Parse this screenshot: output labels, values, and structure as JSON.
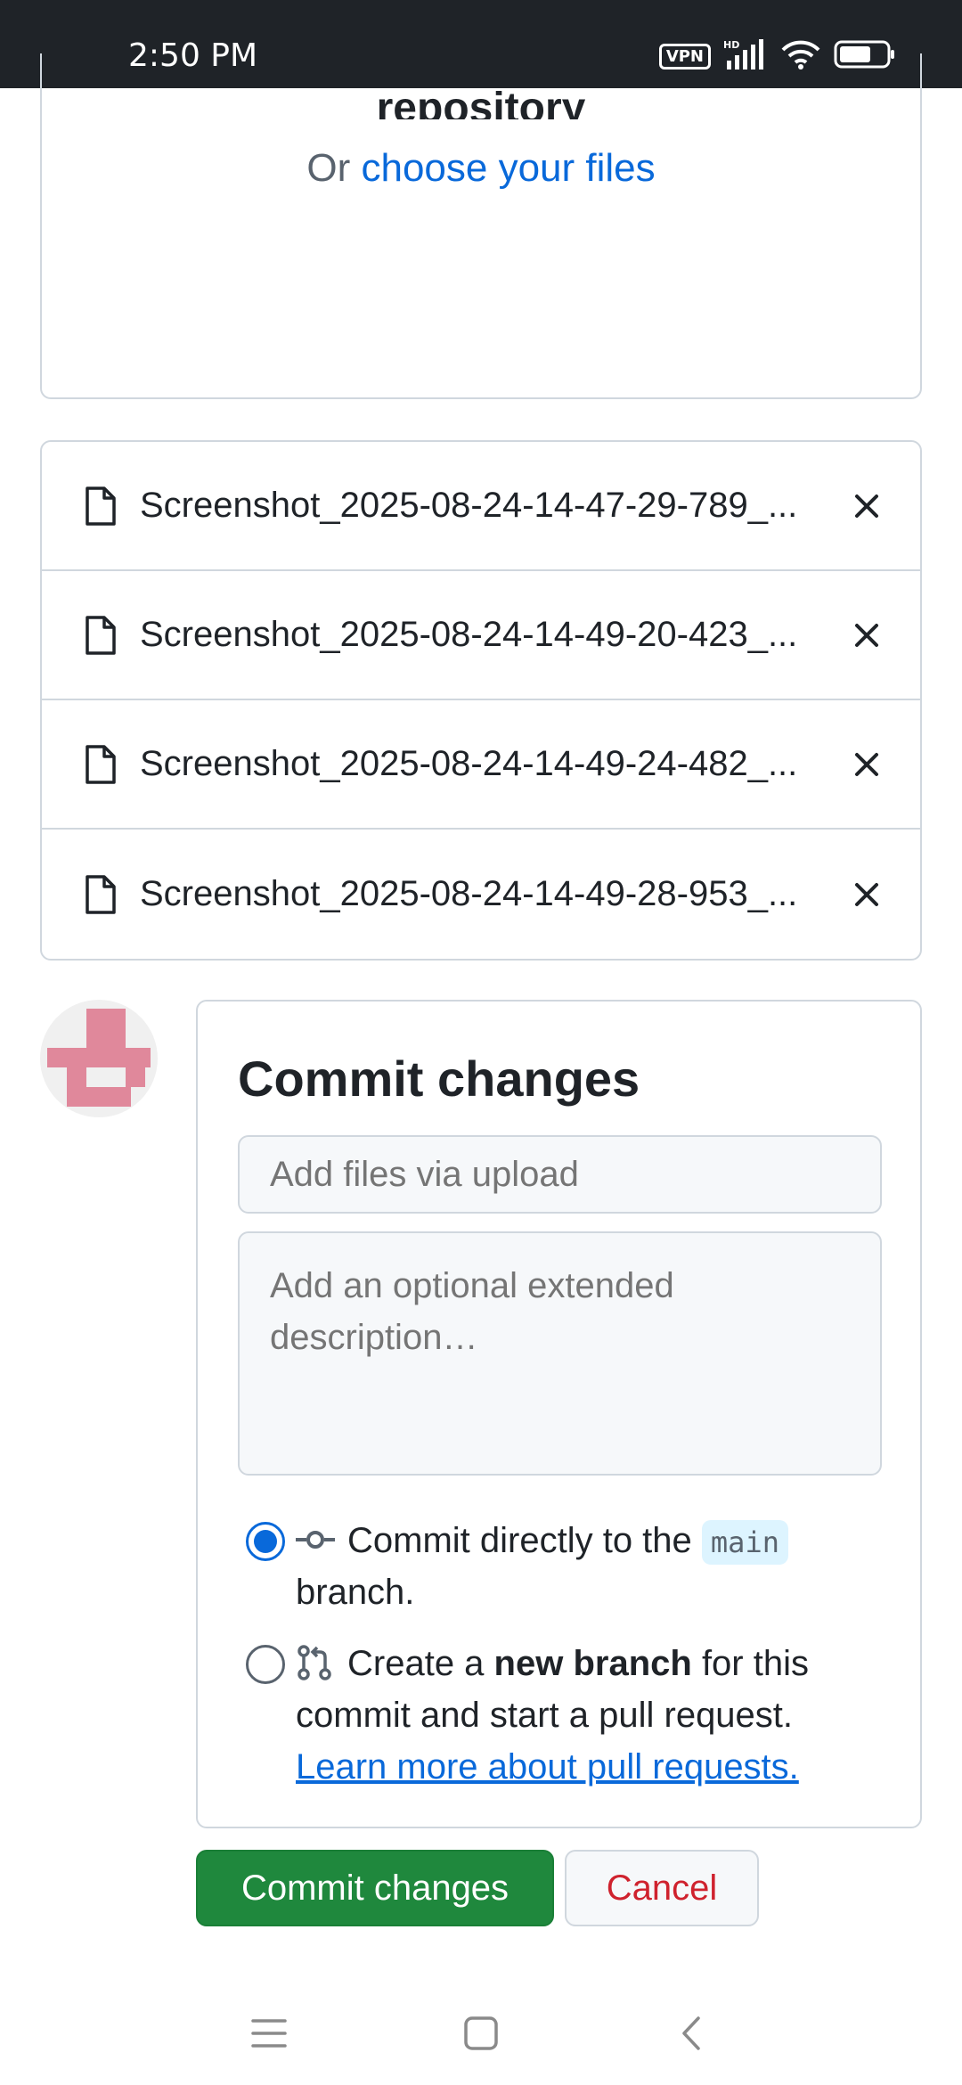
{
  "status_bar": {
    "time": "2:50 PM",
    "vpn": "VPN",
    "network": "HD"
  },
  "dropzone": {
    "title": "repository",
    "prefix": "Or",
    "link": "choose your files"
  },
  "files": [
    {
      "name": "Screenshot_2025-08-24-14-47-29-789_..."
    },
    {
      "name": "Screenshot_2025-08-24-14-49-20-423_..."
    },
    {
      "name": "Screenshot_2025-08-24-14-49-24-482_..."
    },
    {
      "name": "Screenshot_2025-08-24-14-49-28-953_..."
    }
  ],
  "commit": {
    "title": "Commit changes",
    "summary_placeholder": "Add files via upload",
    "description_placeholder": "Add an optional extended description…",
    "option_direct": {
      "prefix": "Commit directly to the",
      "branch": "main",
      "suffix": "branch.",
      "selected": true
    },
    "option_new_branch": {
      "prefix": "Create a",
      "bold": "new branch",
      "suffix": "for this commit and start a pull request.",
      "link": "Learn more about pull requests.",
      "selected": false
    }
  },
  "buttons": {
    "commit_label": "Commit changes",
    "cancel_label": "Cancel"
  },
  "colors": {
    "link": "#0969da",
    "primary_button": "#1f883d",
    "danger_text": "#cf222e",
    "avatar": "#e0889b"
  }
}
